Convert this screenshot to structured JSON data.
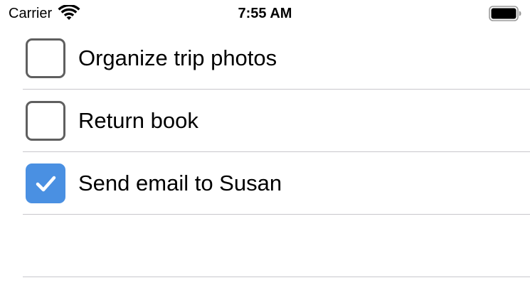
{
  "status_bar": {
    "carrier": "Carrier",
    "time": "7:55 AM",
    "wifi_icon": "wifi-icon",
    "battery_icon": "battery-full-icon"
  },
  "todo_list": {
    "items": [
      {
        "label": "Organize trip photos",
        "checked": false
      },
      {
        "label": "Return book",
        "checked": false
      },
      {
        "label": "Send email to Susan",
        "checked": true
      },
      {
        "label": "",
        "checked": null
      }
    ]
  },
  "colors": {
    "checked_fill": "#4a90e2",
    "unchecked_border": "#5f5f5f",
    "separator": "#c8c7cc"
  }
}
